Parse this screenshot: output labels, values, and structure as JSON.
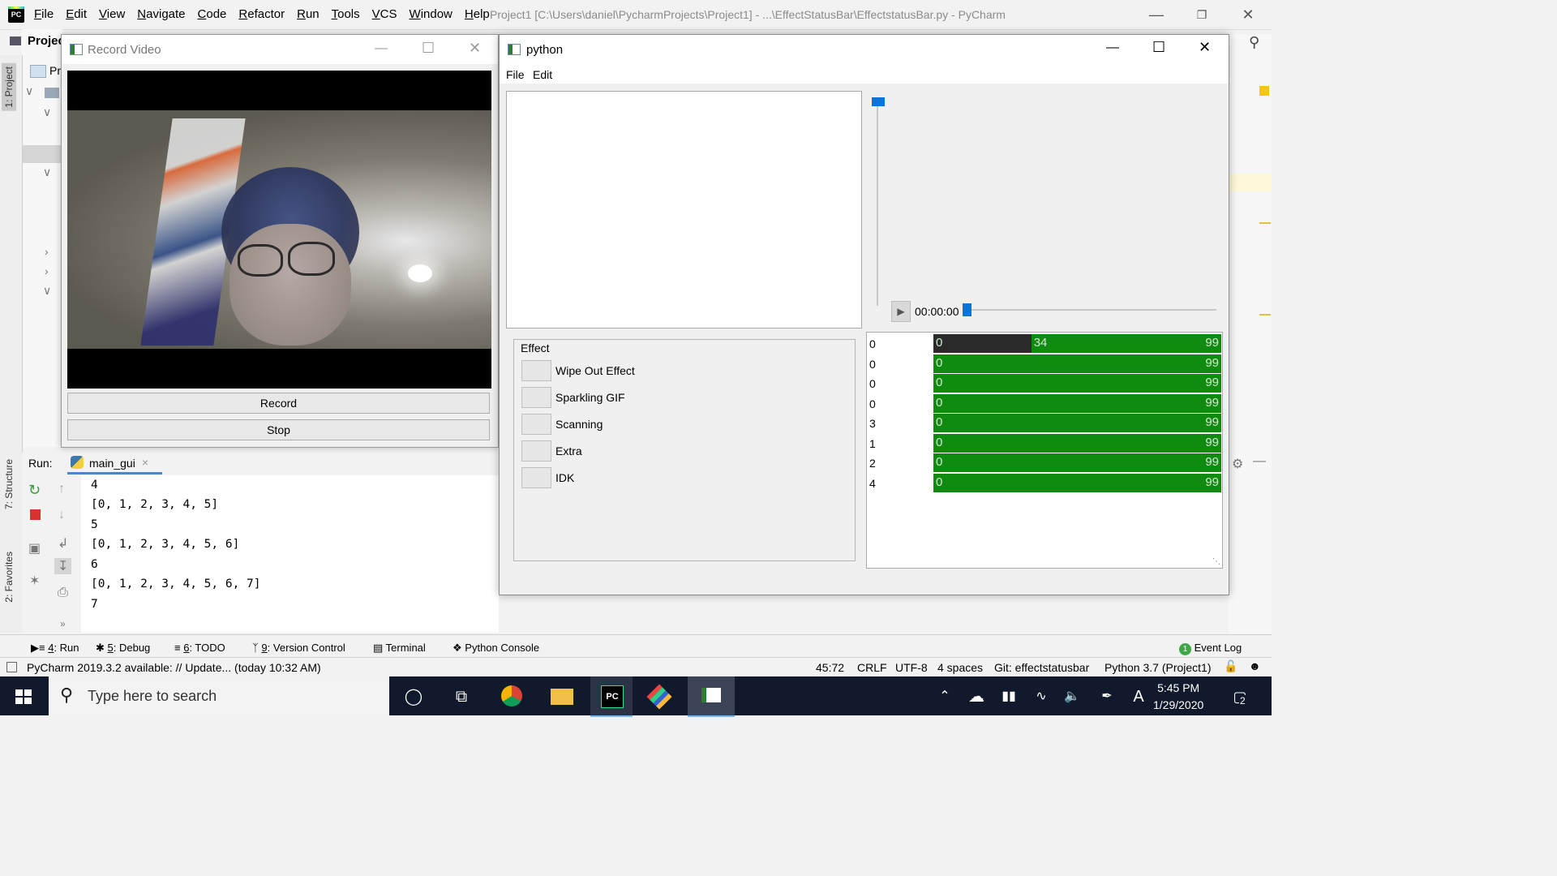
{
  "ide": {
    "logo_text": "PC",
    "menu": [
      "File",
      "Edit",
      "View",
      "Navigate",
      "Code",
      "Refactor",
      "Run",
      "Tools",
      "VCS",
      "Window",
      "Help"
    ],
    "title_path": "Project1 [C:\\Users\\daniel\\PycharmProjects\\Project1] - ...\\EffectStatusBar\\EffectstatusBar.py - PyCharm",
    "project_header": "Projec",
    "project_item": "Pr"
  },
  "left_tabs": {
    "project": "1: Project",
    "structure": "7: Structure",
    "favorites": "2: Favorites"
  },
  "record_window": {
    "title": "Record Video",
    "record_label": "Record",
    "stop_label": "Stop"
  },
  "python_window": {
    "title": "python",
    "menu": [
      "File",
      "Edit"
    ],
    "time": "00:00:00",
    "time_position": 0,
    "volume_level": 1.0,
    "effect_group_title": "Effect",
    "effects": [
      "Wipe Out Effect",
      "Sparkling GIF",
      "Scanning",
      "Extra",
      "IDK"
    ],
    "rows": [
      {
        "num": "0",
        "lo": "0",
        "mid": "34",
        "hi": "99",
        "progress": 0.34
      },
      {
        "num": "0",
        "lo": "0",
        "mid": "",
        "hi": "99",
        "progress": 0
      },
      {
        "num": "0",
        "lo": "0",
        "mid": "",
        "hi": "99",
        "progress": 0
      },
      {
        "num": "0",
        "lo": "0",
        "mid": "",
        "hi": "99",
        "progress": 0
      },
      {
        "num": "3",
        "lo": "0",
        "mid": "",
        "hi": "99",
        "progress": 0
      },
      {
        "num": "1",
        "lo": "0",
        "mid": "",
        "hi": "99",
        "progress": 0
      },
      {
        "num": "2",
        "lo": "0",
        "mid": "",
        "hi": "99",
        "progress": 0
      },
      {
        "num": "4",
        "lo": "0",
        "mid": "",
        "hi": "99",
        "progress": 0
      }
    ]
  },
  "run": {
    "label": "Run:",
    "tab": "main_gui",
    "output": [
      "4",
      "[0, 1, 2, 3, 4, 5]",
      "5",
      "[0, 1, 2, 3, 4, 5, 6]",
      "6",
      "[0, 1, 2, 3, 4, 5, 6, 7]",
      "7"
    ]
  },
  "bottom_tabs": {
    "run": {
      "key": "4",
      "label": ": Run"
    },
    "debug": {
      "key": "5",
      "label": ": Debug"
    },
    "todo": {
      "key": "6",
      "label": ": TODO"
    },
    "vcs": {
      "key": "9",
      "label": ": Version Control"
    },
    "terminal": "Terminal",
    "python_console": "Python Console",
    "event_log": "Event Log",
    "event_count": "1"
  },
  "status": {
    "message": "PyCharm 2019.3.2 available: // Update... (today 10:32 AM)",
    "position": "45:72",
    "line_sep": "CRLF",
    "encoding": "UTF-8",
    "indent": "4 spaces",
    "git": "Git: effectstatusbar",
    "interpreter": "Python 3.7 (Project1)"
  },
  "taskbar": {
    "search_placeholder": "Type here to search",
    "time": "5:45 PM",
    "date": "1/29/2020",
    "notification_count": "2",
    "ime": "A"
  },
  "colors": {
    "progress_green": "#0f8b0f",
    "slider_blue": "#0a74d8",
    "taskbar": "#101a2c"
  }
}
